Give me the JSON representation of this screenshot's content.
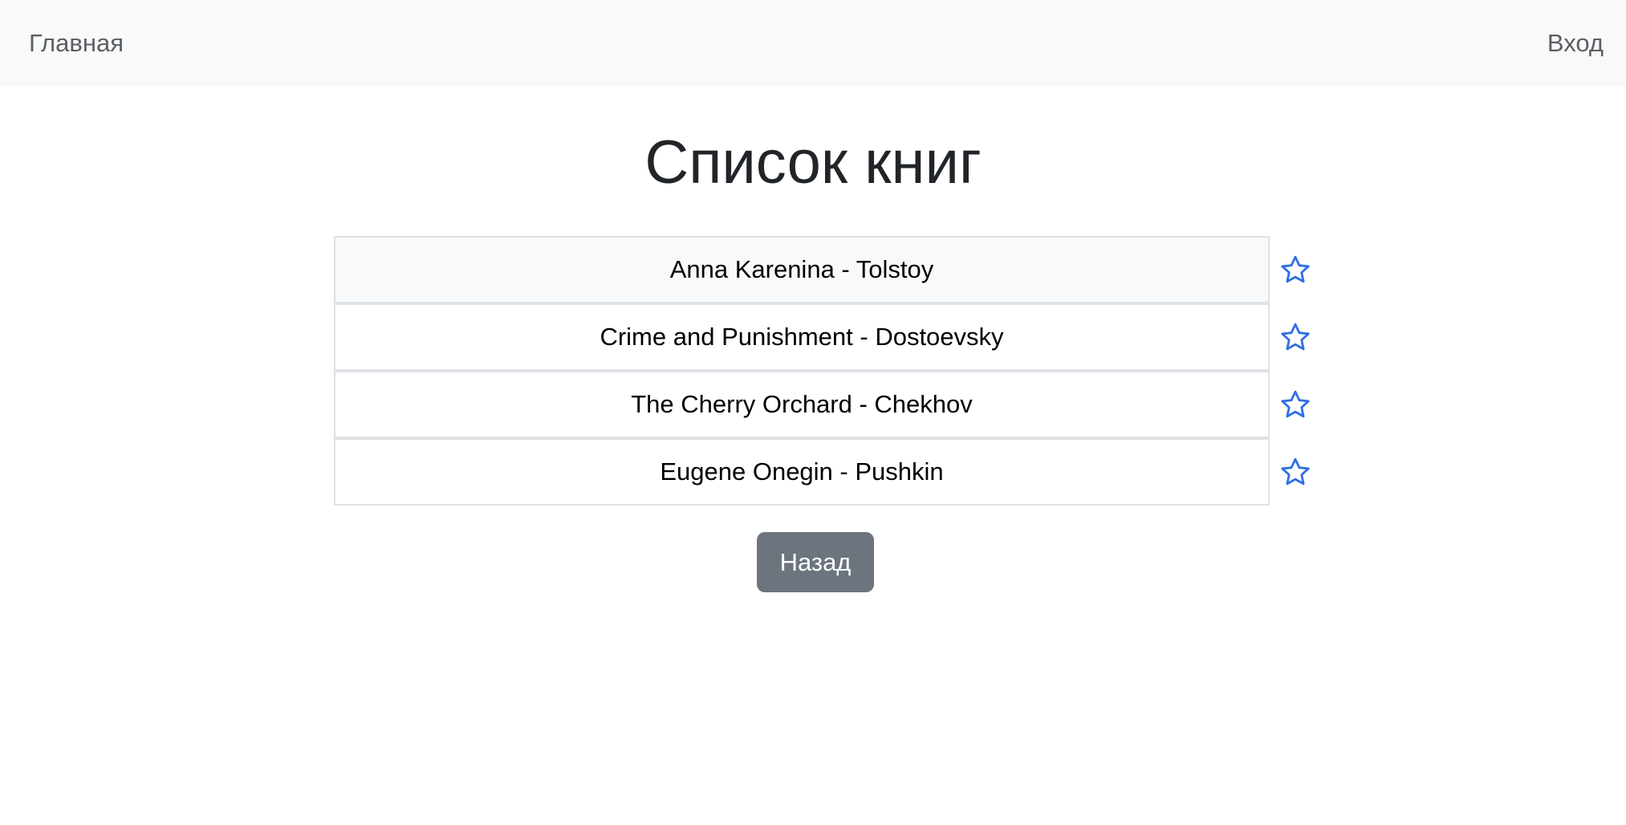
{
  "navbar": {
    "home_label": "Главная",
    "login_label": "Вход"
  },
  "page": {
    "title": "Список книг"
  },
  "books": [
    {
      "label": "Anna Karenina - Tolstoy",
      "favorite_icon": "star-outline-icon"
    },
    {
      "label": "Crime and Punishment - Dostoevsky",
      "favorite_icon": "star-outline-icon"
    },
    {
      "label": "The Cherry Orchard - Chekhov",
      "favorite_icon": "star-outline-icon"
    },
    {
      "label": "Eugene Onegin - Pushkin",
      "favorite_icon": "star-outline-icon"
    }
  ],
  "back_button": {
    "label": "Назад"
  },
  "colors": {
    "navbar_background": "#f8f9fa",
    "star_color": "#2f6fe4",
    "back_button_background": "#6c757d",
    "border": "#dee2e6"
  }
}
